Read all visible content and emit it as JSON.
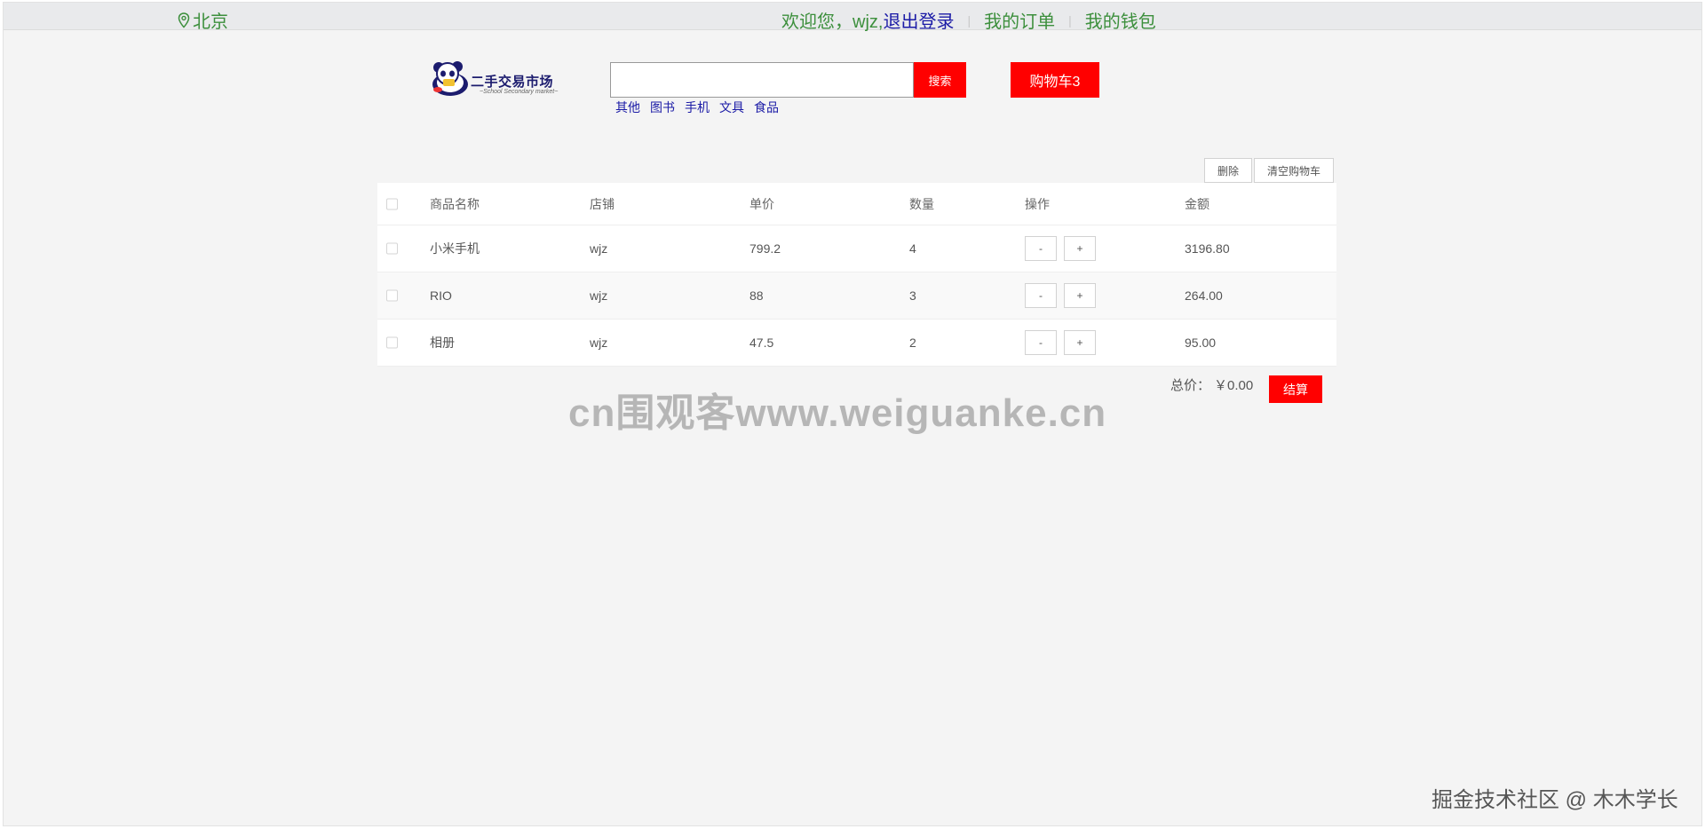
{
  "topbar": {
    "location": "北京",
    "welcome": "欢迎您，wjz,",
    "logout": "退出登录",
    "orders": "我的订单",
    "wallet": "我的钱包",
    "separator": "|"
  },
  "header": {
    "logo_title": "二手交易市场",
    "logo_subtitle": "~School Secondary market~",
    "search_placeholder": "",
    "search_button": "搜索",
    "cart_button": "购物车3",
    "quick_categories": [
      "其他",
      "图书",
      "手机",
      "文具",
      "食品"
    ]
  },
  "toolbar": {
    "delete_label": "删除",
    "clear_label": "清空购物车"
  },
  "table": {
    "headers": {
      "name": "商品名称",
      "shop": "店铺",
      "price": "单价",
      "qty": "数量",
      "op": "操作",
      "amount": "金额"
    },
    "rows": [
      {
        "name": "小米手机",
        "shop": "wjz",
        "price": "799.2",
        "qty": "4",
        "minus": "-",
        "plus": "+",
        "amount": "3196.80"
      },
      {
        "name": "RIO",
        "shop": "wjz",
        "price": "88",
        "qty": "3",
        "minus": "-",
        "plus": "+",
        "amount": "264.00"
      },
      {
        "name": "相册",
        "shop": "wjz",
        "price": "47.5",
        "qty": "2",
        "minus": "-",
        "plus": "+",
        "amount": "95.00"
      }
    ]
  },
  "summary": {
    "label": "总价：",
    "value": "￥0.00",
    "checkout": "结算"
  },
  "watermark": "cn围观客www.weiguanke.cn",
  "credit": "掘金技术社区 @ 木木学长",
  "colors": {
    "accent_red": "#ff0000",
    "nav_green": "#3c8f3c",
    "link_blue": "#1a1aa6"
  }
}
